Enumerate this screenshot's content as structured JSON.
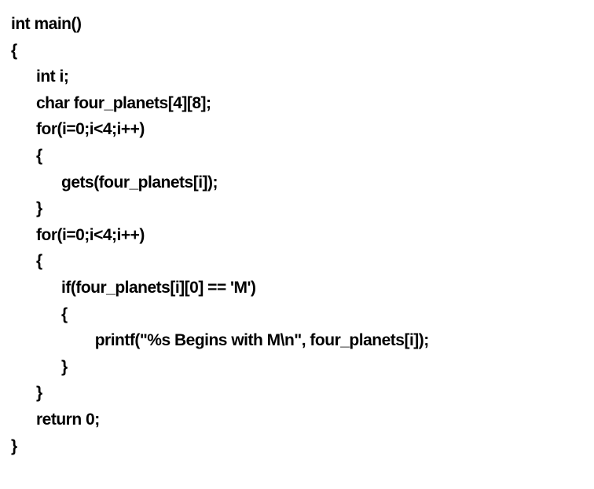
{
  "code": {
    "lines": [
      "int main()",
      "{",
      "      int i;",
      "      char four_planets[4][8];",
      "      for(i=0;i<4;i++)",
      "      {",
      "            gets(four_planets[i]);",
      "      }",
      "      for(i=0;i<4;i++)",
      "      {",
      "            if(four_planets[i][0] == 'M')",
      "            {",
      "                    printf(\"%s Begins with M\\n\", four_planets[i]);",
      "            }",
      "      }",
      "      return 0;",
      "}"
    ]
  }
}
